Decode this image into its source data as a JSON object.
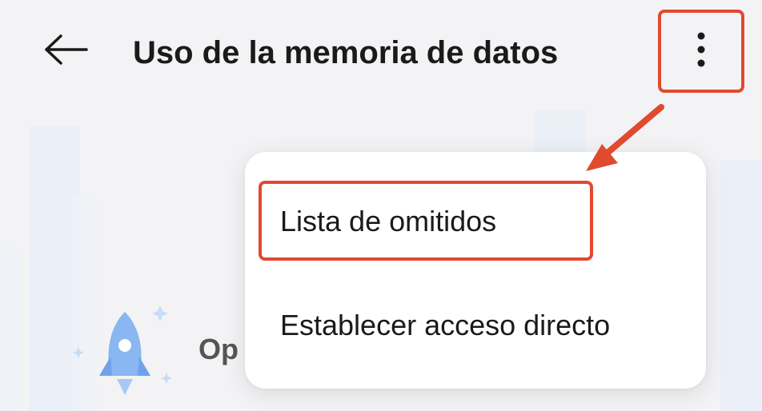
{
  "header": {
    "back_icon": "arrow-left-icon",
    "title": "Uso de la memoria de datos",
    "more_icon": "more-vertical-icon"
  },
  "menu": {
    "items": [
      {
        "label": "Lista de omitidos",
        "highlighted": true
      },
      {
        "label": "Establecer acceso directo",
        "highlighted": false
      }
    ]
  },
  "promo": {
    "icon": "rocket-icon",
    "text": "Op"
  },
  "colors": {
    "background": "#f3f3f5",
    "menu_bg": "#ffffff",
    "highlight": "#e04a2f",
    "rocket": "#8ab6f2"
  }
}
